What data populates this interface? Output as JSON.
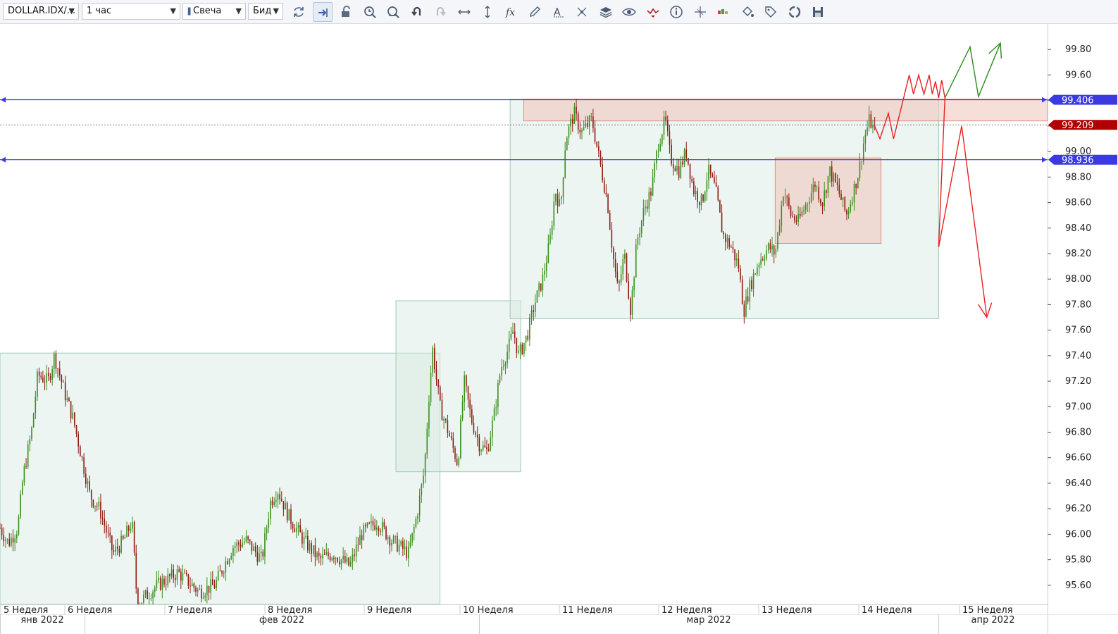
{
  "toolbar": {
    "symbol": "DOLLAR.IDX/...",
    "timeframe": "1 час",
    "chart_style": "Свеча",
    "price_side": "Бид",
    "tools": [
      "refresh-icon",
      "shift-chart-icon",
      "lock-icon",
      "zoom-in-icon",
      "zoom-out-icon",
      "undo-icon",
      "redo-icon",
      "horizontal-scale-icon",
      "vertical-scale-icon",
      "indicators-fx-icon",
      "pencil-draw-icon",
      "text-tool-icon",
      "pattern-tool-icon",
      "layers-icon",
      "eye-icon",
      "trade-signal-icon",
      "info-icon",
      "crosshair-icon",
      "volume-profile-icon",
      "paint-bucket-icon",
      "tag-icon",
      "circle-refresh-icon",
      "save-icon"
    ]
  },
  "colors": {
    "bull": "#3a8f1c",
    "bear": "#8f1a12",
    "level_line": "#3a3ae0",
    "current_price": "#b00000",
    "zone_green": "#d9ece4",
    "zone_red": "#f0c8c0",
    "forecast_up": "#2d8a1d",
    "forecast_red": "#e82020"
  },
  "price_axis": {
    "ticks": [
      "99.80",
      "99.60",
      "99.40",
      "99.20",
      "99.00",
      "98.80",
      "98.60",
      "98.40",
      "98.20",
      "98.00",
      "97.80",
      "97.60",
      "97.40",
      "97.20",
      "97.00",
      "96.80",
      "96.60",
      "96.40",
      "96.20",
      "96.00",
      "95.80",
      "95.60"
    ],
    "tick_values": [
      99.8,
      99.6,
      99.4,
      99.2,
      99.0,
      98.8,
      98.6,
      98.4,
      98.2,
      98.0,
      97.8,
      97.6,
      97.4,
      97.2,
      97.0,
      96.8,
      96.6,
      96.4,
      96.2,
      96.0,
      95.8,
      95.6
    ],
    "labels": [
      {
        "text": "99.406",
        "value": 99.406,
        "kind": "level"
      },
      {
        "text": "99.209",
        "value": 99.209,
        "kind": "current"
      },
      {
        "text": "98.936",
        "value": 98.936,
        "kind": "level"
      }
    ]
  },
  "time_axis": {
    "weeks": [
      "5 Неделя",
      "6 Неделя",
      "7 Неделя",
      "8 Неделя",
      "9 Неделя",
      "10 Неделя",
      "11 Неделя",
      "12 Неделя",
      "13 Неделя",
      "14 Неделя",
      "15 Неделя"
    ],
    "months": [
      "янв 2022",
      "фев 2022",
      "мар 2022",
      "апр 2022"
    ]
  },
  "chart_data": {
    "type": "candlestick",
    "symbol": "DOLLAR.IDX",
    "timeframe": "1 час",
    "ylim": [
      95.45,
      100.0
    ],
    "current_price": 99.209,
    "levels": [
      99.406,
      98.936
    ],
    "zones": [
      {
        "color": "green",
        "x": [
          0.0,
          0.42
        ],
        "y": [
          95.45,
          97.42
        ]
      },
      {
        "color": "green",
        "x": [
          0.378,
          0.497
        ],
        "y": [
          96.49,
          97.83
        ]
      },
      {
        "color": "green",
        "x": [
          0.487,
          0.896
        ],
        "y": [
          97.69,
          99.41
        ]
      },
      {
        "color": "red",
        "x": [
          0.5,
          1.0
        ],
        "y": [
          99.24,
          99.41
        ]
      },
      {
        "color": "red",
        "x": [
          0.74,
          0.841
        ],
        "y": [
          98.28,
          98.95
        ]
      }
    ],
    "price_path": [
      {
        "x": 0.0,
        "y": 96.05
      },
      {
        "x": 0.008,
        "y": 95.93
      },
      {
        "x": 0.017,
        "y": 96.05
      },
      {
        "x": 0.022,
        "y": 96.45
      },
      {
        "x": 0.03,
        "y": 96.8
      },
      {
        "x": 0.036,
        "y": 97.25
      },
      {
        "x": 0.046,
        "y": 97.2
      },
      {
        "x": 0.052,
        "y": 97.4
      },
      {
        "x": 0.062,
        "y": 97.1
      },
      {
        "x": 0.07,
        "y": 96.9
      },
      {
        "x": 0.078,
        "y": 96.6
      },
      {
        "x": 0.086,
        "y": 96.3
      },
      {
        "x": 0.095,
        "y": 96.2
      },
      {
        "x": 0.108,
        "y": 95.85
      },
      {
        "x": 0.118,
        "y": 95.95
      },
      {
        "x": 0.126,
        "y": 96.1
      },
      {
        "x": 0.131,
        "y": 95.45
      },
      {
        "x": 0.15,
        "y": 95.6
      },
      {
        "x": 0.17,
        "y": 95.7
      },
      {
        "x": 0.19,
        "y": 95.55
      },
      {
        "x": 0.205,
        "y": 95.6
      },
      {
        "x": 0.222,
        "y": 95.9
      },
      {
        "x": 0.235,
        "y": 95.95
      },
      {
        "x": 0.25,
        "y": 95.8
      },
      {
        "x": 0.258,
        "y": 96.25
      },
      {
        "x": 0.265,
        "y": 96.35
      },
      {
        "x": 0.275,
        "y": 96.15
      },
      {
        "x": 0.29,
        "y": 95.95
      },
      {
        "x": 0.305,
        "y": 95.8
      },
      {
        "x": 0.318,
        "y": 95.85
      },
      {
        "x": 0.334,
        "y": 95.75
      },
      {
        "x": 0.345,
        "y": 96.0
      },
      {
        "x": 0.36,
        "y": 96.1
      },
      {
        "x": 0.374,
        "y": 95.95
      },
      {
        "x": 0.39,
        "y": 95.85
      },
      {
        "x": 0.398,
        "y": 96.15
      },
      {
        "x": 0.405,
        "y": 96.5
      },
      {
        "x": 0.41,
        "y": 97.15
      },
      {
        "x": 0.413,
        "y": 97.45
      },
      {
        "x": 0.42,
        "y": 97.0
      },
      {
        "x": 0.428,
        "y": 96.8
      },
      {
        "x": 0.437,
        "y": 96.55
      },
      {
        "x": 0.443,
        "y": 97.2
      },
      {
        "x": 0.45,
        "y": 96.9
      },
      {
        "x": 0.458,
        "y": 96.7
      },
      {
        "x": 0.465,
        "y": 96.65
      },
      {
        "x": 0.472,
        "y": 96.95
      },
      {
        "x": 0.478,
        "y": 97.3
      },
      {
        "x": 0.485,
        "y": 97.45
      },
      {
        "x": 0.49,
        "y": 97.6
      },
      {
        "x": 0.495,
        "y": 97.4
      },
      {
        "x": 0.503,
        "y": 97.55
      },
      {
        "x": 0.51,
        "y": 97.8
      },
      {
        "x": 0.518,
        "y": 98.0
      },
      {
        "x": 0.525,
        "y": 98.3
      },
      {
        "x": 0.53,
        "y": 98.7
      },
      {
        "x": 0.535,
        "y": 98.55
      },
      {
        "x": 0.54,
        "y": 99.1
      },
      {
        "x": 0.548,
        "y": 99.3
      },
      {
        "x": 0.555,
        "y": 99.15
      },
      {
        "x": 0.565,
        "y": 99.25
      },
      {
        "x": 0.573,
        "y": 98.9
      },
      {
        "x": 0.58,
        "y": 98.6
      },
      {
        "x": 0.585,
        "y": 98.2
      },
      {
        "x": 0.59,
        "y": 97.9
      },
      {
        "x": 0.596,
        "y": 98.2
      },
      {
        "x": 0.602,
        "y": 97.75
      },
      {
        "x": 0.608,
        "y": 98.3
      },
      {
        "x": 0.615,
        "y": 98.55
      },
      {
        "x": 0.622,
        "y": 98.7
      },
      {
        "x": 0.628,
        "y": 99.05
      },
      {
        "x": 0.635,
        "y": 99.25
      },
      {
        "x": 0.64,
        "y": 98.95
      },
      {
        "x": 0.648,
        "y": 98.85
      },
      {
        "x": 0.655,
        "y": 99.0
      },
      {
        "x": 0.662,
        "y": 98.7
      },
      {
        "x": 0.67,
        "y": 98.6
      },
      {
        "x": 0.676,
        "y": 98.85
      },
      {
        "x": 0.683,
        "y": 98.7
      },
      {
        "x": 0.69,
        "y": 98.35
      },
      {
        "x": 0.698,
        "y": 98.25
      },
      {
        "x": 0.705,
        "y": 98.1
      },
      {
        "x": 0.71,
        "y": 97.75
      },
      {
        "x": 0.716,
        "y": 97.95
      },
      {
        "x": 0.725,
        "y": 98.15
      },
      {
        "x": 0.734,
        "y": 98.25
      },
      {
        "x": 0.74,
        "y": 98.2
      },
      {
        "x": 0.748,
        "y": 98.7
      },
      {
        "x": 0.755,
        "y": 98.5
      },
      {
        "x": 0.762,
        "y": 98.45
      },
      {
        "x": 0.77,
        "y": 98.6
      },
      {
        "x": 0.778,
        "y": 98.75
      },
      {
        "x": 0.785,
        "y": 98.6
      },
      {
        "x": 0.792,
        "y": 98.85
      },
      {
        "x": 0.8,
        "y": 98.7
      },
      {
        "x": 0.808,
        "y": 98.5
      },
      {
        "x": 0.815,
        "y": 98.7
      },
      {
        "x": 0.82,
        "y": 98.85
      },
      {
        "x": 0.825,
        "y": 99.1
      },
      {
        "x": 0.83,
        "y": 99.25
      },
      {
        "x": 0.835,
        "y": 99.15
      }
    ],
    "forecasts": [
      {
        "color": "red",
        "points": [
          {
            "x": 0.835,
            "y": 99.2
          },
          {
            "x": 0.84,
            "y": 99.1
          },
          {
            "x": 0.848,
            "y": 99.3
          },
          {
            "x": 0.853,
            "y": 99.1
          },
          {
            "x": 0.862,
            "y": 99.4
          },
          {
            "x": 0.868,
            "y": 99.6
          },
          {
            "x": 0.872,
            "y": 99.45
          },
          {
            "x": 0.877,
            "y": 99.6
          },
          {
            "x": 0.882,
            "y": 99.45
          },
          {
            "x": 0.887,
            "y": 99.6
          },
          {
            "x": 0.89,
            "y": 99.45
          },
          {
            "x": 0.893,
            "y": 99.55
          },
          {
            "x": 0.896,
            "y": 99.42
          },
          {
            "x": 0.899,
            "y": 99.56
          },
          {
            "x": 0.902,
            "y": 99.42
          }
        ]
      },
      {
        "color": "green",
        "points": [
          {
            "x": 0.902,
            "y": 99.42
          },
          {
            "x": 0.926,
            "y": 99.82
          },
          {
            "x": 0.934,
            "y": 99.43
          },
          {
            "x": 0.955,
            "y": 99.85
          }
        ],
        "arrow": true
      },
      {
        "color": "red",
        "points": [
          {
            "x": 0.902,
            "y": 99.42
          },
          {
            "x": 0.896,
            "y": 98.25
          },
          {
            "x": 0.918,
            "y": 99.2
          },
          {
            "x": 0.942,
            "y": 97.7
          }
        ],
        "arrow": true
      }
    ]
  }
}
